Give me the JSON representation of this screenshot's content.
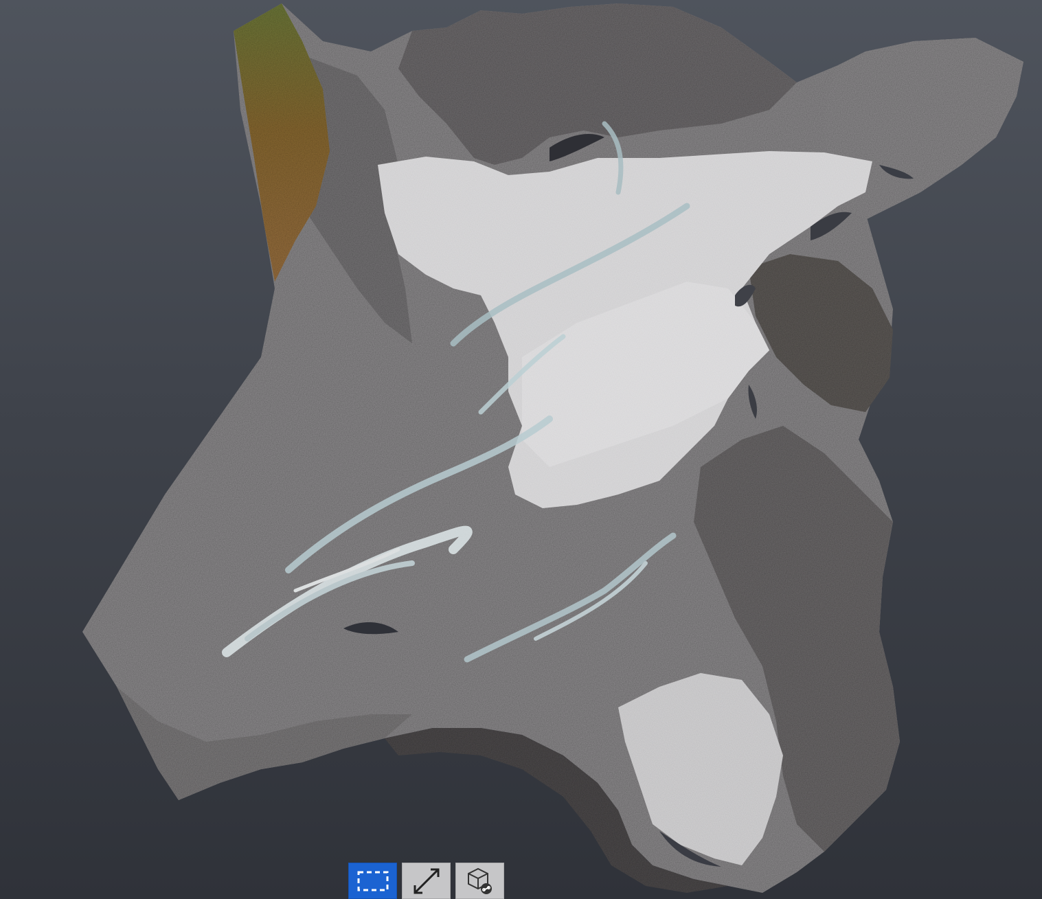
{
  "viewer": {
    "background_top": "#4f545d",
    "background_bottom": "#2f3239",
    "content": "point-cloud-terrain"
  },
  "toolbar": {
    "active_color": "#1b63d2",
    "inactive_color": "#c6c6c8",
    "tools": [
      {
        "id": "select",
        "icon": "rectangle-select-icon",
        "active": true
      },
      {
        "id": "measure",
        "icon": "measure-distance-icon",
        "active": false
      },
      {
        "id": "model",
        "icon": "cube-link-icon",
        "active": false
      }
    ]
  }
}
